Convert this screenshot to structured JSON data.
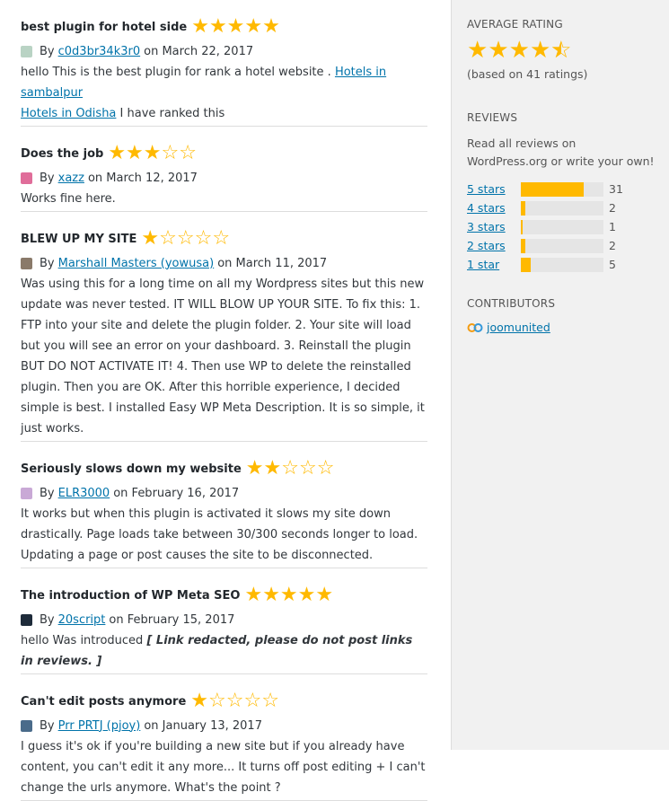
{
  "reviews": [
    {
      "title": "best plugin for hotel side",
      "rating": 5,
      "by": "By",
      "author": "c0d3br34k3r0",
      "on": "on",
      "date": "March 22, 2017",
      "avatar_color": "#b9d3c4",
      "body_parts": [
        {
          "type": "text",
          "text": "hello This is the best plugin for rank a hotel website . "
        },
        {
          "type": "link",
          "text": "Hotels in sambalpur"
        },
        {
          "type": "break"
        },
        {
          "type": "link",
          "text": "Hotels in Odisha"
        },
        {
          "type": "text",
          "text": " I have ranked this"
        }
      ]
    },
    {
      "title": "Does the job",
      "rating": 3,
      "by": "By",
      "author": "xazz",
      "on": "on",
      "date": "March 12, 2017",
      "avatar_color": "#e06d9a",
      "body_parts": [
        {
          "type": "text",
          "text": "Works fine here."
        }
      ]
    },
    {
      "title": "BLEW UP MY SITE",
      "rating": 1,
      "by": "By",
      "author": "Marshall Masters (yowusa)",
      "on": "on",
      "date": "March 11, 2017",
      "avatar_color": "#8a7a6a",
      "body_parts": [
        {
          "type": "text",
          "text": "Was using this for a long time on all my Wordpress sites but this new update was never tested. IT WILL BLOW UP YOUR SITE. To fix this: 1. FTP into your site and delete the plugin folder. 2. Your site will load but you will see an error on your dashboard. 3. Reinstall the plugin BUT DO NOT ACTIVATE IT! 4. Then use WP to delete the reinstalled plugin. Then you are OK. After this horrible experience, I decided simple is best. I installed Easy WP Meta Description. It is so simple, it just works."
        }
      ]
    },
    {
      "title": "Seriously slows down my website",
      "rating": 2,
      "by": "By",
      "author": "ELR3000",
      "on": "on",
      "date": "February 16, 2017",
      "avatar_color": "#c9a9d6",
      "body_parts": [
        {
          "type": "text",
          "text": "It works but when this plugin is activated it slows my site down drastically. Page loads take between 30/300 seconds longer to load. Updating a page or post causes the site to be disconnected."
        }
      ]
    },
    {
      "title": "The introduction of WP Meta SEO",
      "rating": 5,
      "by": "By",
      "author": "20script",
      "on": "on",
      "date": "February 15, 2017",
      "avatar_color": "#1e2b3a",
      "body_parts": [
        {
          "type": "text",
          "text": "hello Was introduced "
        },
        {
          "type": "em",
          "text": "[ Link redacted, please do not post links in reviews. ]"
        }
      ]
    },
    {
      "title": "Can't edit posts anymore",
      "rating": 1,
      "by": "By",
      "author": "Prr PRTJ (pjoy)",
      "on": "on",
      "date": "January 13, 2017",
      "avatar_color": "#4a6b8a",
      "body_parts": [
        {
          "type": "text",
          "text": "I guess it's ok if you're building a new site but if you already have content, you can't edit it any more... It turns off post editing + I can't change the urls anymore. What's the point ?"
        }
      ]
    }
  ],
  "sidebar": {
    "average_heading": "AVERAGE RATING",
    "average_rating": 4.5,
    "based_on": "(based on 41 ratings)",
    "reviews_heading": "REVIEWS",
    "reviews_text": "Read all reviews on WordPress.org or write your own!",
    "breakdown": [
      {
        "label": "5 stars",
        "count": "31",
        "fraction": 0.756
      },
      {
        "label": "4 stars",
        "count": "2",
        "fraction": 0.049
      },
      {
        "label": "3 stars",
        "count": "1",
        "fraction": 0.024
      },
      {
        "label": "2 stars",
        "count": "2",
        "fraction": 0.049
      },
      {
        "label": "1 star",
        "count": "5",
        "fraction": 0.122
      }
    ],
    "contributors_heading": "CONTRIBUTORS",
    "contributor": "joomunited"
  },
  "colors": {
    "star": "#ffb900",
    "link": "#0073aa",
    "bar_bg": "#e5e5e5",
    "sidebar_bg": "#f1f1f1"
  }
}
